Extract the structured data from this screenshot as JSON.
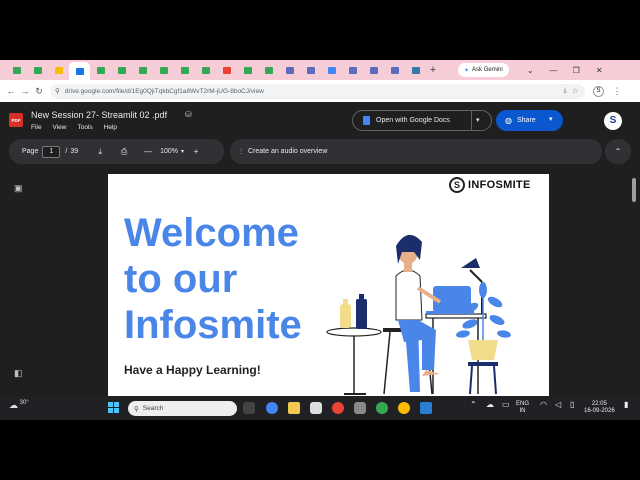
{
  "browser": {
    "tab_count_visible": 21,
    "gemini_label": "Ask Gemini",
    "url": "drive.google.com/file/d/1Eg0QjiTqkbCgf1a8WvT2rM-jUG-8boCJ/view"
  },
  "viewer": {
    "file_badge": "PDF",
    "title": "New Session 27- Streamlit 02 .pdf",
    "menus": [
      "File",
      "View",
      "Tools",
      "Help"
    ],
    "open_with_label": "Open with Google Docs",
    "share_label": "Share",
    "account_initial": "S"
  },
  "toolbar": {
    "page_label": "Page",
    "current_page": "1",
    "page_separator": "/",
    "total_pages": "39",
    "zoom_minus": "—",
    "zoom_level": "100%",
    "zoom_plus": "+",
    "audio_label": "Create an audio overview"
  },
  "pdf_page": {
    "brand_logo": "S",
    "brand_name": "INFOSMITE",
    "heading_line1": "Welcome",
    "heading_line2": "to our",
    "heading_line3": "Infosmite",
    "tagline": "Have a Happy Learning!"
  },
  "taskbar": {
    "temperature": "30°",
    "search_placeholder": "Search",
    "lang_top": "ENG",
    "lang_bottom": "IN",
    "time": "22:05",
    "date": "16-09-2026"
  },
  "colors": {
    "accent_blue": "#4a86e8",
    "share_blue": "#0b57d0",
    "tabstrip_pink": "#f6cdd6",
    "pdf_red": "#d93025"
  }
}
